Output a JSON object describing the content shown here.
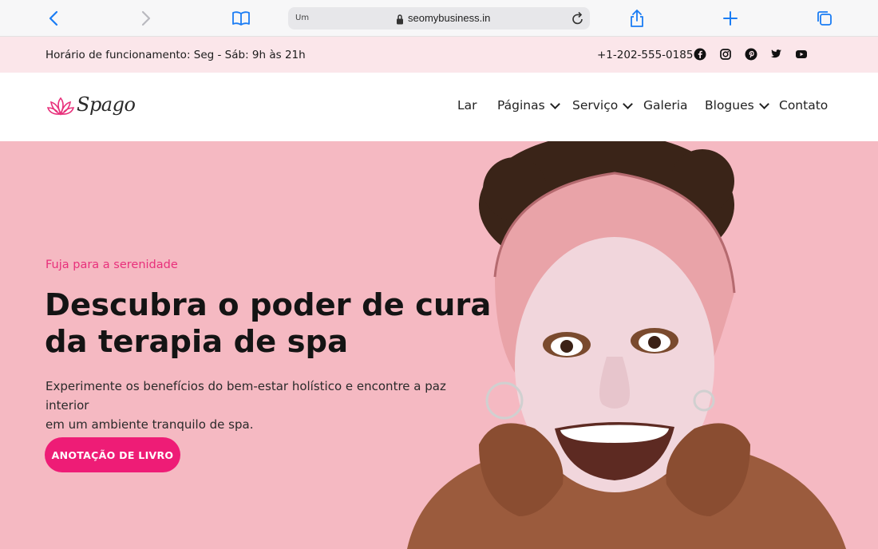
{
  "browser": {
    "reader_label": "Um",
    "url": "seomybusiness.in",
    "icons": [
      "back-icon",
      "forward-icon",
      "book-icon",
      "lock-icon",
      "reload-icon",
      "share-icon",
      "plus-icon",
      "tabs-icon"
    ]
  },
  "info_bar": {
    "hours": "Horário de funcionamento: Seg - Sáb: 9h às 21h",
    "phone": "+1-202-555-0185",
    "social": [
      "facebook-icon",
      "instagram-icon",
      "pinterest-icon",
      "twitter-icon",
      "youtube-icon"
    ]
  },
  "nav": {
    "logo_text": "Spago",
    "items": [
      {
        "label": "Lar",
        "dropdown": false
      },
      {
        "label": "Páginas",
        "dropdown": true
      },
      {
        "label": "Serviço",
        "dropdown": true
      },
      {
        "label": "Galeria",
        "dropdown": false
      },
      {
        "label": "Blogues",
        "dropdown": true
      },
      {
        "label": "Contato",
        "dropdown": false
      }
    ]
  },
  "hero": {
    "eyebrow": "Fuja para a serenidade",
    "headline_line1": "Descubra o poder de cura",
    "headline_line2": "da terapia de spa",
    "description_line1": "Experimente os benefícios do bem-estar holístico e encontre a paz interior",
    "description_line2": "em um ambiente tranquilo de spa.",
    "cta_label": "ANOTAÇÃO DE LIVRO"
  },
  "colors": {
    "accent": "#ee1c76",
    "info_bar_bg": "#fbe6ea",
    "hero_bg": "#f5b9c2",
    "browser_blue": "#1a7cf4"
  }
}
